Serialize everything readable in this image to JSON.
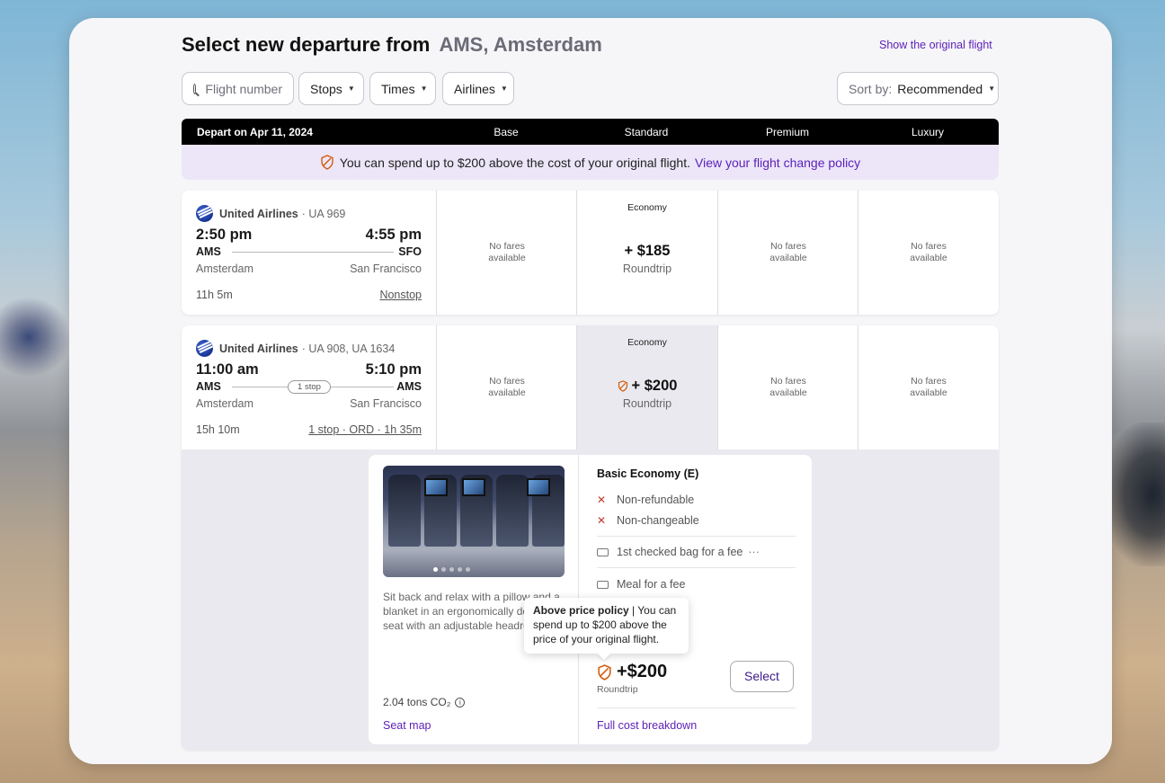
{
  "page": {
    "title_prefix": "Select new departure from",
    "title_city": "AMS, Amsterdam",
    "show_original_label": "Show the original flight"
  },
  "filters": {
    "search_placeholder": "Flight number",
    "stops": "Stops",
    "times": "Times",
    "airlines": "Airlines",
    "sort_label": "Sort by:",
    "sort_value": "Recommended"
  },
  "table_header": {
    "depart": "Depart on Apr 11, 2024",
    "columns": [
      "Base",
      "Standard",
      "Premium",
      "Luxury"
    ]
  },
  "policy_banner": {
    "text": "You can spend up to $200 above the cost of your original flight.",
    "link": "View your flight change policy"
  },
  "flights": [
    {
      "airline": "United Airlines",
      "flight_no": "· UA 969",
      "depart_time": "2:50 pm",
      "arrive_time": "4:55 pm",
      "from_code": "AMS",
      "to_code": "SFO",
      "from_city": "Amsterdam",
      "to_city": "San Francisco",
      "duration": "11h 5m",
      "route": "Nonstop",
      "fares": {
        "base": "No fares available",
        "standard_cabin": "Economy",
        "standard_price": "+ $185",
        "standard_trip": "Roundtrip",
        "premium": "No fares available",
        "luxury": "No fares available"
      }
    },
    {
      "airline": "United Airlines",
      "flight_no": "· UA 908, UA 1634",
      "depart_time": "11:00 am",
      "arrive_time": "5:10 pm",
      "from_code": "AMS",
      "to_code": "AMS",
      "stop_pill": "1 stop",
      "from_city": "Amsterdam",
      "to_city": "San Francisco",
      "duration": "15h 10m",
      "route": "1 stop · ORD · 1h 35m",
      "fares": {
        "base": "No fares available",
        "standard_cabin": "Economy",
        "standard_price": "+ $200",
        "standard_trip": "Roundtrip",
        "premium": "No fares available",
        "luxury": "No fares available"
      }
    }
  ],
  "detail": {
    "description": "Sit back and relax with a pillow and a blanket in an ergonomically designed seat with an adjustable headrest.",
    "co2": "2.04 tons CO₂",
    "seat_map": "Seat map",
    "fare_title": "Basic Economy (E)",
    "features": [
      "Non-refundable",
      "Non-changeable",
      "1st checked bag for a fee",
      "Meal for a fee"
    ],
    "more": "···",
    "tooltip_bold": "Above price policy",
    "tooltip_text": " | You can spend up to $200 above the price of your original flight.",
    "price": "+$200",
    "trip": "Roundtrip",
    "select": "Select",
    "full_cost": "Full cost breakdown"
  },
  "colors": {
    "accent": "#5b1fb8",
    "banner_bg": "#ece6f8",
    "header_bg": "#000000",
    "policy_shield": "#d35400"
  }
}
